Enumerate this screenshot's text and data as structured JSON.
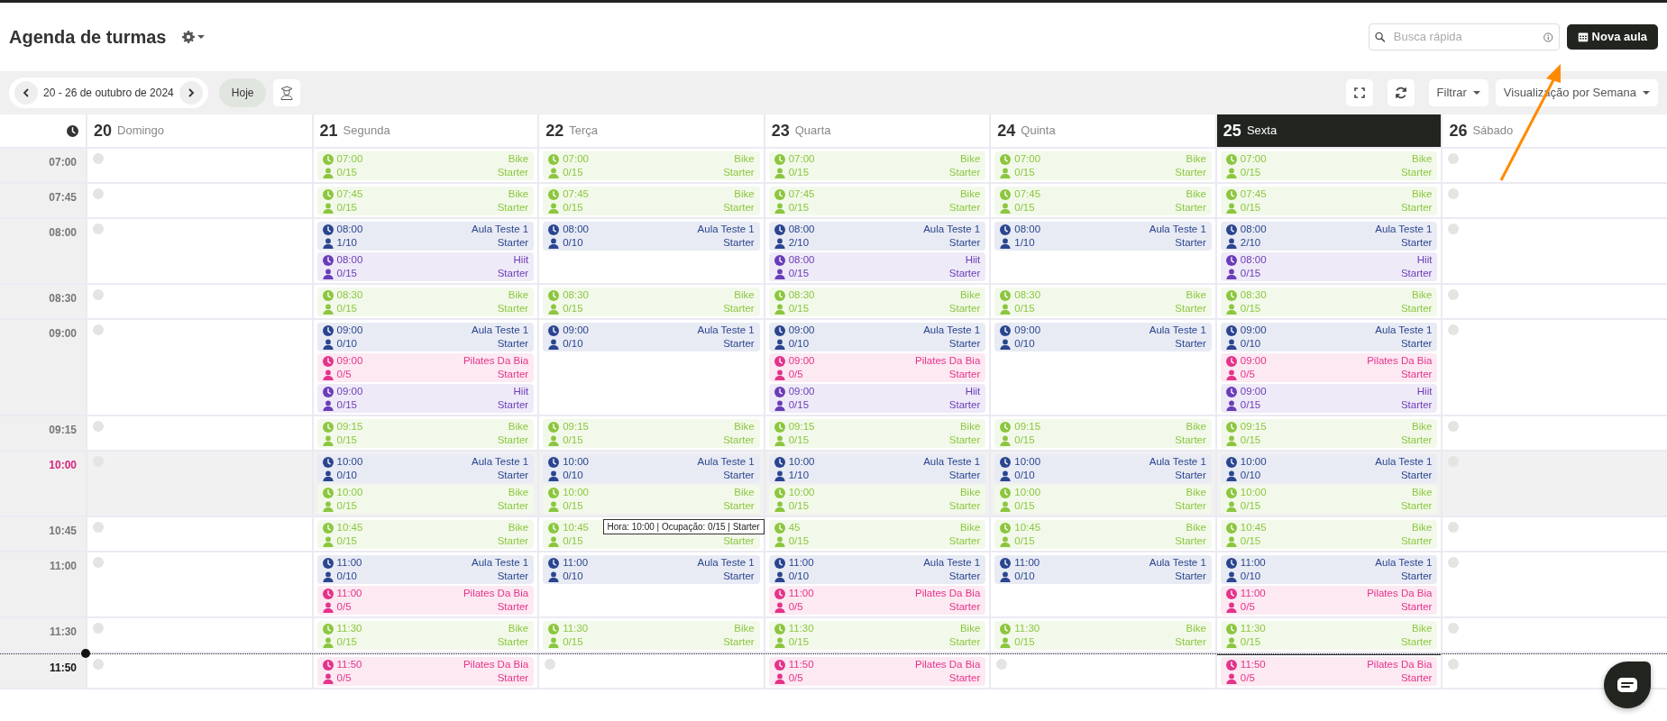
{
  "page": {
    "title": "Agenda de turmas"
  },
  "search": {
    "placeholder": "Busca rápida"
  },
  "new_button": "Nova aula",
  "toolbar": {
    "range": "20 - 26 de outubro de 2024",
    "today": "Hoje",
    "filter": "Filtrar",
    "view": "Visualização por Semana"
  },
  "calendar": {
    "days": [
      {
        "number": "20",
        "name": "Domingo",
        "selected": false
      },
      {
        "number": "21",
        "name": "Segunda",
        "selected": false
      },
      {
        "number": "22",
        "name": "Terça",
        "selected": false
      },
      {
        "number": "23",
        "name": "Quarta",
        "selected": false
      },
      {
        "number": "24",
        "name": "Quinta",
        "selected": false
      },
      {
        "number": "25",
        "name": "Sexta",
        "selected": true
      },
      {
        "number": "26",
        "name": "Sábado",
        "selected": false
      }
    ],
    "rows": [
      {
        "time": "07:00",
        "kind": "normal",
        "cells": [
          {
            "kind": "free"
          },
          {
            "kind": "classes",
            "events": [
              {
                "time": "07:00",
                "name": "Bike",
                "occupancy": "0/15",
                "plan": "Starter",
                "color": "#8cc63f"
              }
            ]
          },
          {
            "kind": "classes",
            "events": [
              {
                "time": "07:00",
                "name": "Bike",
                "occupancy": "0/15",
                "plan": "Starter",
                "color": "#8cc63f"
              }
            ]
          },
          {
            "kind": "classes",
            "events": [
              {
                "time": "07:00",
                "name": "Bike",
                "occupancy": "0/15",
                "plan": "Starter",
                "color": "#8cc63f"
              }
            ]
          },
          {
            "kind": "classes",
            "events": [
              {
                "time": "07:00",
                "name": "Bike",
                "occupancy": "0/15",
                "plan": "Starter",
                "color": "#8cc63f"
              }
            ]
          },
          {
            "kind": "classes",
            "events": [
              {
                "time": "07:00",
                "name": "Bike",
                "occupancy": "0/15",
                "plan": "Starter",
                "color": "#8cc63f"
              }
            ]
          },
          {
            "kind": "free"
          }
        ]
      },
      {
        "time": "07:45",
        "kind": "normal",
        "cells": [
          {
            "kind": "free"
          },
          {
            "kind": "classes",
            "events": [
              {
                "time": "07:45",
                "name": "Bike",
                "occupancy": "0/15",
                "plan": "Starter",
                "color": "#8cc63f"
              }
            ]
          },
          {
            "kind": "classes",
            "events": [
              {
                "time": "07:45",
                "name": "Bike",
                "occupancy": "0/15",
                "plan": "Starter",
                "color": "#8cc63f"
              }
            ]
          },
          {
            "kind": "classes",
            "events": [
              {
                "time": "07:45",
                "name": "Bike",
                "occupancy": "0/15",
                "plan": "Starter",
                "color": "#8cc63f"
              }
            ]
          },
          {
            "kind": "classes",
            "events": [
              {
                "time": "07:45",
                "name": "Bike",
                "occupancy": "0/15",
                "plan": "Starter",
                "color": "#8cc63f"
              }
            ]
          },
          {
            "kind": "classes",
            "events": [
              {
                "time": "07:45",
                "name": "Bike",
                "occupancy": "0/15",
                "plan": "Starter",
                "color": "#8cc63f"
              }
            ]
          },
          {
            "kind": "free"
          }
        ]
      },
      {
        "time": "08:00",
        "kind": "normal",
        "cells": [
          {
            "kind": "free"
          },
          {
            "kind": "classes",
            "events": [
              {
                "time": "08:00",
                "name": "Aula Teste 1",
                "occupancy": "1/10",
                "plan": "Starter",
                "color": "#2b4590"
              },
              {
                "time": "08:00",
                "name": "Hiit",
                "occupancy": "0/15",
                "plan": "Starter",
                "color": "#6a3db8"
              }
            ]
          },
          {
            "kind": "classes",
            "events": [
              {
                "time": "08:00",
                "name": "Aula Teste 1",
                "occupancy": "0/10",
                "plan": "Starter",
                "color": "#2b4590"
              }
            ]
          },
          {
            "kind": "classes",
            "events": [
              {
                "time": "08:00",
                "name": "Aula Teste 1",
                "occupancy": "2/10",
                "plan": "Starter",
                "color": "#2b4590"
              },
              {
                "time": "08:00",
                "name": "Hiit",
                "occupancy": "0/15",
                "plan": "Starter",
                "color": "#6a3db8"
              }
            ]
          },
          {
            "kind": "classes",
            "events": [
              {
                "time": "08:00",
                "name": "Aula Teste 1",
                "occupancy": "1/10",
                "plan": "Starter",
                "color": "#2b4590"
              }
            ]
          },
          {
            "kind": "classes",
            "events": [
              {
                "time": "08:00",
                "name": "Aula Teste 1",
                "occupancy": "2/10",
                "plan": "Starter",
                "color": "#2b4590"
              },
              {
                "time": "08:00",
                "name": "Hiit",
                "occupancy": "0/15",
                "plan": "Starter",
                "color": "#6a3db8"
              }
            ]
          },
          {
            "kind": "free"
          }
        ]
      },
      {
        "time": "08:30",
        "kind": "normal",
        "cells": [
          {
            "kind": "free"
          },
          {
            "kind": "classes",
            "events": [
              {
                "time": "08:30",
                "name": "Bike",
                "occupancy": "0/15",
                "plan": "Starter",
                "color": "#8cc63f"
              }
            ]
          },
          {
            "kind": "classes",
            "events": [
              {
                "time": "08:30",
                "name": "Bike",
                "occupancy": "0/15",
                "plan": "Starter",
                "color": "#8cc63f"
              }
            ]
          },
          {
            "kind": "classes",
            "events": [
              {
                "time": "08:30",
                "name": "Bike",
                "occupancy": "0/15",
                "plan": "Starter",
                "color": "#8cc63f"
              }
            ]
          },
          {
            "kind": "classes",
            "events": [
              {
                "time": "08:30",
                "name": "Bike",
                "occupancy": "0/15",
                "plan": "Starter",
                "color": "#8cc63f"
              }
            ]
          },
          {
            "kind": "classes",
            "events": [
              {
                "time": "08:30",
                "name": "Bike",
                "occupancy": "0/15",
                "plan": "Starter",
                "color": "#8cc63f"
              }
            ]
          },
          {
            "kind": "free"
          }
        ]
      },
      {
        "time": "09:00",
        "kind": "normal",
        "cells": [
          {
            "kind": "free"
          },
          {
            "kind": "classes",
            "events": [
              {
                "time": "09:00",
                "name": "Aula Teste 1",
                "occupancy": "0/10",
                "plan": "Starter",
                "color": "#2b4590"
              },
              {
                "time": "09:00",
                "name": "Pilates Da Bia",
                "occupancy": "0/5",
                "plan": "Starter",
                "color": "#e5338a"
              },
              {
                "time": "09:00",
                "name": "Hiit",
                "occupancy": "0/15",
                "plan": "Starter",
                "color": "#6a3db8"
              }
            ]
          },
          {
            "kind": "classes",
            "events": [
              {
                "time": "09:00",
                "name": "Aula Teste 1",
                "occupancy": "0/10",
                "plan": "Starter",
                "color": "#2b4590"
              }
            ]
          },
          {
            "kind": "classes",
            "events": [
              {
                "time": "09:00",
                "name": "Aula Teste 1",
                "occupancy": "0/10",
                "plan": "Starter",
                "color": "#2b4590"
              },
              {
                "time": "09:00",
                "name": "Pilates Da Bia",
                "occupancy": "0/5",
                "plan": "Starter",
                "color": "#e5338a"
              },
              {
                "time": "09:00",
                "name": "Hiit",
                "occupancy": "0/15",
                "plan": "Starter",
                "color": "#6a3db8"
              }
            ]
          },
          {
            "kind": "classes",
            "events": [
              {
                "time": "09:00",
                "name": "Aula Teste 1",
                "occupancy": "0/10",
                "plan": "Starter",
                "color": "#2b4590"
              }
            ]
          },
          {
            "kind": "classes",
            "events": [
              {
                "time": "09:00",
                "name": "Aula Teste 1",
                "occupancy": "0/10",
                "plan": "Starter",
                "color": "#2b4590"
              },
              {
                "time": "09:00",
                "name": "Pilates Da Bia",
                "occupancy": "0/5",
                "plan": "Starter",
                "color": "#e5338a"
              },
              {
                "time": "09:00",
                "name": "Hiit",
                "occupancy": "0/15",
                "plan": "Starter",
                "color": "#6a3db8"
              }
            ]
          },
          {
            "kind": "free"
          }
        ]
      },
      {
        "time": "09:15",
        "kind": "normal",
        "cells": [
          {
            "kind": "free"
          },
          {
            "kind": "classes",
            "events": [
              {
                "time": "09:15",
                "name": "Bike",
                "occupancy": "0/15",
                "plan": "Starter",
                "color": "#8cc63f"
              }
            ]
          },
          {
            "kind": "classes",
            "events": [
              {
                "time": "09:15",
                "name": "Bike",
                "occupancy": "0/15",
                "plan": "Starter",
                "color": "#8cc63f"
              }
            ]
          },
          {
            "kind": "classes",
            "events": [
              {
                "time": "09:15",
                "name": "Bike",
                "occupancy": "0/15",
                "plan": "Starter",
                "color": "#8cc63f"
              }
            ]
          },
          {
            "kind": "classes",
            "events": [
              {
                "time": "09:15",
                "name": "Bike",
                "occupancy": "0/15",
                "plan": "Starter",
                "color": "#8cc63f"
              }
            ]
          },
          {
            "kind": "classes",
            "events": [
              {
                "time": "09:15",
                "name": "Bike",
                "occupancy": "0/15",
                "plan": "Starter",
                "color": "#8cc63f"
              }
            ]
          },
          {
            "kind": "free"
          }
        ]
      },
      {
        "time": "10:00",
        "kind": "current",
        "cells": [
          {
            "kind": "free"
          },
          {
            "kind": "classes",
            "events": [
              {
                "time": "10:00",
                "name": "Aula Teste 1",
                "occupancy": "0/10",
                "plan": "Starter",
                "color": "#2b4590"
              },
              {
                "time": "10:00",
                "name": "Bike",
                "occupancy": "0/15",
                "plan": "Starter",
                "color": "#8cc63f"
              }
            ]
          },
          {
            "kind": "classes",
            "events": [
              {
                "time": "10:00",
                "name": "Aula Teste 1",
                "occupancy": "0/10",
                "plan": "Starter",
                "color": "#2b4590"
              },
              {
                "time": "10:00",
                "name": "Bike",
                "occupancy": "0/15",
                "plan": "Starter",
                "color": "#8cc63f"
              }
            ]
          },
          {
            "kind": "classes",
            "events": [
              {
                "time": "10:00",
                "name": "Aula Teste 1",
                "occupancy": "1/10",
                "plan": "Starter",
                "color": "#2b4590"
              },
              {
                "time": "10:00",
                "name": "Bike",
                "occupancy": "0/15",
                "plan": "Starter",
                "color": "#8cc63f"
              }
            ]
          },
          {
            "kind": "classes",
            "events": [
              {
                "time": "10:00",
                "name": "Aula Teste 1",
                "occupancy": "0/10",
                "plan": "Starter",
                "color": "#2b4590"
              },
              {
                "time": "10:00",
                "name": "Bike",
                "occupancy": "0/15",
                "plan": "Starter",
                "color": "#8cc63f"
              }
            ]
          },
          {
            "kind": "classes",
            "events": [
              {
                "time": "10:00",
                "name": "Aula Teste 1",
                "occupancy": "0/10",
                "plan": "Starter",
                "color": "#2b4590"
              },
              {
                "time": "10:00",
                "name": "Bike",
                "occupancy": "0/15",
                "plan": "Starter",
                "color": "#8cc63f"
              }
            ]
          },
          {
            "kind": "free"
          }
        ]
      },
      {
        "time": "10:45",
        "kind": "normal",
        "cells": [
          {
            "kind": "free"
          },
          {
            "kind": "classes",
            "events": [
              {
                "time": "10:45",
                "name": "Bike",
                "occupancy": "0/15",
                "plan": "Starter",
                "color": "#8cc63f"
              }
            ]
          },
          {
            "kind": "classes",
            "tooltip": "Hora: 10:00 | Ocupação: 0/15 | Starter",
            "events": [
              {
                "time": "10:45",
                "occupancy": "0/15",
                "plan": "Starter",
                "color": "#8cc63f"
              }
            ]
          },
          {
            "kind": "classes",
            "events": [
              {
                "time": "45",
                "name": "Bike",
                "occupancy": "0/15",
                "plan": "Starter",
                "color": "#8cc63f"
              }
            ]
          },
          {
            "kind": "classes",
            "events": [
              {
                "time": "10:45",
                "name": "Bike",
                "occupancy": "0/15",
                "plan": "Starter",
                "color": "#8cc63f"
              }
            ]
          },
          {
            "kind": "classes",
            "events": [
              {
                "time": "10:45",
                "name": "Bike",
                "occupancy": "0/15",
                "plan": "Starter",
                "color": "#8cc63f"
              }
            ]
          },
          {
            "kind": "free"
          }
        ]
      },
      {
        "time": "11:00",
        "kind": "normal",
        "cells": [
          {
            "kind": "free"
          },
          {
            "kind": "classes",
            "events": [
              {
                "time": "11:00",
                "name": "Aula Teste 1",
                "occupancy": "0/10",
                "plan": "Starter",
                "color": "#2b4590"
              },
              {
                "time": "11:00",
                "name": "Pilates Da Bia",
                "occupancy": "0/5",
                "plan": "Starter",
                "color": "#e5338a"
              }
            ]
          },
          {
            "kind": "classes",
            "events": [
              {
                "time": "11:00",
                "name": "Aula Teste 1",
                "occupancy": "0/10",
                "plan": "Starter",
                "color": "#2b4590"
              }
            ]
          },
          {
            "kind": "classes",
            "events": [
              {
                "time": "11:00",
                "name": "Aula Teste 1",
                "occupancy": "0/10",
                "plan": "Starter",
                "color": "#2b4590"
              },
              {
                "time": "11:00",
                "name": "Pilates Da Bia",
                "occupancy": "0/5",
                "plan": "Starter",
                "color": "#e5338a"
              }
            ]
          },
          {
            "kind": "classes",
            "events": [
              {
                "time": "11:00",
                "name": "Aula Teste 1",
                "occupancy": "0/10",
                "plan": "Starter",
                "color": "#2b4590"
              }
            ]
          },
          {
            "kind": "classes",
            "events": [
              {
                "time": "11:00",
                "name": "Aula Teste 1",
                "occupancy": "0/10",
                "plan": "Starter",
                "color": "#2b4590"
              },
              {
                "time": "11:00",
                "name": "Pilates Da Bia",
                "occupancy": "0/5",
                "plan": "Starter",
                "color": "#e5338a"
              }
            ]
          },
          {
            "kind": "free"
          }
        ]
      },
      {
        "time": "11:30",
        "kind": "normal",
        "cells": [
          {
            "kind": "free"
          },
          {
            "kind": "classes",
            "events": [
              {
                "time": "11:30",
                "name": "Bike",
                "occupancy": "0/15",
                "plan": "Starter",
                "color": "#8cc63f"
              }
            ]
          },
          {
            "kind": "classes",
            "events": [
              {
                "time": "11:30",
                "name": "Bike",
                "occupancy": "0/15",
                "plan": "Starter",
                "color": "#8cc63f"
              }
            ]
          },
          {
            "kind": "classes",
            "events": [
              {
                "time": "11:30",
                "name": "Bike",
                "occupancy": "0/15",
                "plan": "Starter",
                "color": "#8cc63f"
              }
            ]
          },
          {
            "kind": "classes",
            "events": [
              {
                "time": "11:30",
                "name": "Bike",
                "occupancy": "0/15",
                "plan": "Starter",
                "color": "#8cc63f"
              }
            ]
          },
          {
            "kind": "classes",
            "events": [
              {
                "time": "11:30",
                "name": "Bike",
                "occupancy": "0/15",
                "plan": "Starter",
                "color": "#8cc63f"
              }
            ]
          },
          {
            "kind": "free"
          }
        ]
      },
      {
        "time": "11:50",
        "kind": "now",
        "cells": [
          {
            "kind": "free"
          },
          {
            "kind": "classes",
            "events": [
              {
                "time": "11:50",
                "name": "Pilates Da Bia",
                "occupancy": "0/5",
                "plan": "Starter",
                "color": "#e5338a"
              }
            ]
          },
          {
            "kind": "free"
          },
          {
            "kind": "classes",
            "events": [
              {
                "time": "11:50",
                "name": "Pilates Da Bia",
                "occupancy": "0/5",
                "plan": "Starter",
                "color": "#e5338a"
              }
            ]
          },
          {
            "kind": "free"
          },
          {
            "kind": "classes",
            "events": [
              {
                "time": "11:50",
                "name": "Pilates Da Bia",
                "occupancy": "0/5",
                "plan": "Starter",
                "color": "#e5338a"
              }
            ]
          },
          {
            "kind": "free"
          }
        ]
      }
    ]
  }
}
